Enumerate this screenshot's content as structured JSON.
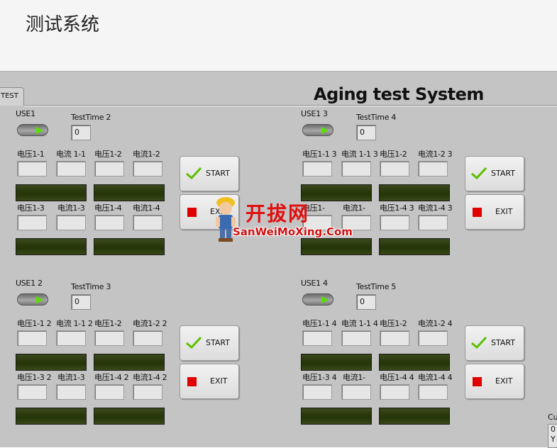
{
  "header": {
    "title": "测试系统"
  },
  "tab": {
    "label": "TEST"
  },
  "system_title": "Aging test System",
  "groups": [
    {
      "switch_label": "USE1",
      "time_label": "TestTime 2",
      "time_value": "0",
      "row1_labels": [
        "电压1-1",
        "电流 1-1",
        "电压1-2",
        "电流1-2"
      ],
      "row2_labels": [
        "电压1-3",
        "电流1-3",
        "电压1-4",
        "电流1-4"
      ],
      "start_label": "START",
      "exit_label": "EXIT"
    },
    {
      "switch_label": "USE1 3",
      "time_label": "TestTime 4",
      "time_value": "0",
      "row1_labels": [
        "电压1-1 3",
        "电流 1-1 3",
        "电压1-2",
        "电流1-2 3"
      ],
      "row2_labels": [
        "电压1-",
        "电流1-",
        "电压1-4 3",
        "电流1-4 3"
      ],
      "start_label": "START",
      "exit_label": "EXIT"
    },
    {
      "switch_label": "USE1 2",
      "time_label": "TestTime 3",
      "time_value": "0",
      "row1_labels": [
        "电压1-1 2",
        "电流 1-1 2",
        "电压1-2",
        "电流1-2 2"
      ],
      "row2_labels": [
        "电压1-3 2",
        "电流1-3",
        "电压1-4 2",
        "电流1-4 2"
      ],
      "start_label": "START",
      "exit_label": "EXIT"
    },
    {
      "switch_label": "USE1 4",
      "time_label": "TestTime 5",
      "time_value": "0",
      "row1_labels": [
        "电压1-1 4",
        "电流 1-1 4",
        "电压1-2",
        "电流1-2 4"
      ],
      "row2_labels": [
        "电压1-3 4",
        "电流1-",
        "电压1-4 4",
        "电流1-4 4"
      ],
      "start_label": "START",
      "exit_label": "EXIT"
    }
  ],
  "watermark": {
    "cn": "开拔网",
    "en": "SanWeiMoXing.Com"
  },
  "corner": {
    "label": "Cu",
    "line1": "0",
    "line2": "Y"
  },
  "colors": {
    "panel": "#c4c4c4",
    "bar": "#2a3a0c",
    "switch_on": "#58e000",
    "exit_square": "#e00000",
    "check": "#5cc000"
  },
  "icons": {
    "start": "check-icon",
    "exit": "stop-square-icon"
  }
}
